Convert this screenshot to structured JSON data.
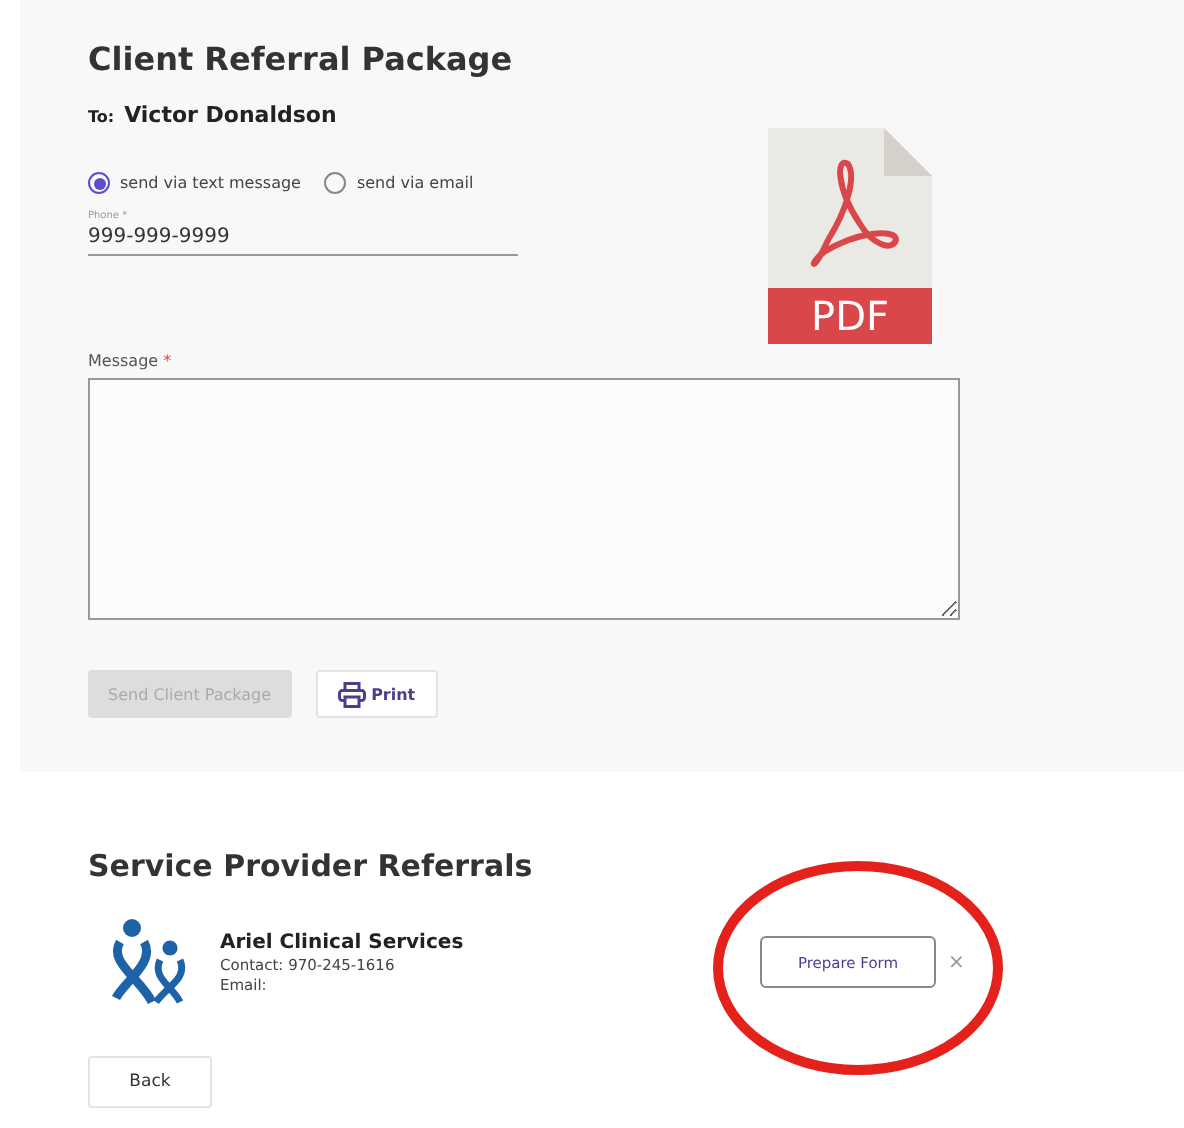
{
  "client_package": {
    "title": "Client Referral Package",
    "to_label": "To:",
    "recipient": "Victor Donaldson",
    "send_options": [
      {
        "label": "send via text message",
        "selected": true
      },
      {
        "label": "send via email",
        "selected": false
      }
    ],
    "phone": {
      "label": "Phone *",
      "value": "999-999-9999"
    },
    "attachment": {
      "label": "PDF"
    },
    "message": {
      "label": "Message",
      "required_mark": "*"
    },
    "buttons": [
      {
        "kind": "primary",
        "label": "Send Client Package",
        "disabled": true
      },
      {
        "kind": "print",
        "label": "Print",
        "disabled": false
      }
    ]
  },
  "service_referrals": {
    "title": "Service Provider Referrals",
    "providers": [
      {
        "name": "Ariel Clinical Services",
        "contact": "Contact: 970-245-1616",
        "email": "Email:",
        "action": "Prepare Form",
        "remove": "×"
      }
    ]
  },
  "back_button": "Back"
}
